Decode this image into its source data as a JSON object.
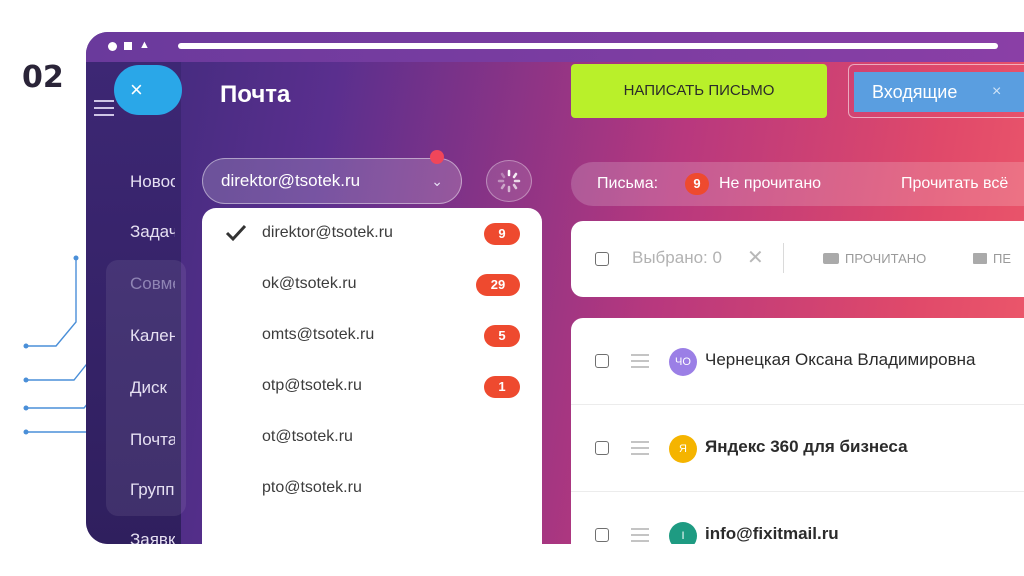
{
  "step_label": "02",
  "nav": {
    "items": [
      "Новости",
      "Задачи",
      "Совместная работа",
      "Календарь",
      "Диск",
      "Почта",
      "Группы",
      "Заявки"
    ],
    "close_label": "×"
  },
  "panel": {
    "title": "Почта"
  },
  "account": {
    "current": "direktor@tsotek.ru",
    "options": [
      {
        "email": "direktor@tsotek.ru",
        "count": "9",
        "selected": true
      },
      {
        "email": "ok@tsotek.ru",
        "count": "29",
        "selected": false
      },
      {
        "email": "omts@tsotek.ru",
        "count": "5",
        "selected": false
      },
      {
        "email": "otp@tsotek.ru",
        "count": "1",
        "selected": false
      },
      {
        "email": "ot@tsotek.ru",
        "count": "",
        "selected": false
      },
      {
        "email": "pto@tsotek.ru",
        "count": "",
        "selected": false
      }
    ]
  },
  "compose_label": "НАПИСАТЬ ПИСЬМО",
  "folder": {
    "label": "Входящие",
    "close": "×"
  },
  "letters_bar": {
    "label": "Письма:",
    "unread_count": "9",
    "unread_label": "Не прочитано",
    "read_all_label": "Прочитать всё"
  },
  "toolbar": {
    "selected_label": "Выбрано: 0",
    "read_label": "ПРОЧИТАНО",
    "move_label": "ПЕ"
  },
  "mails": [
    {
      "avatar": "ЧО",
      "avatar_color": "#9b7fe6",
      "sender": "Чернецкая Оксана Владимировна",
      "bold": false
    },
    {
      "avatar": "Я",
      "avatar_color": "#f5b400",
      "sender": "Яндекс 360 для бизнеса",
      "bold": true
    },
    {
      "avatar": "I",
      "avatar_color": "#1e9b82",
      "sender": "info@fixitmail.ru",
      "bold": true
    }
  ],
  "colors": {
    "accent_compose": "#b9f02a",
    "badge": "#ee4a2f",
    "folder_tab": "#5a9ee0"
  }
}
